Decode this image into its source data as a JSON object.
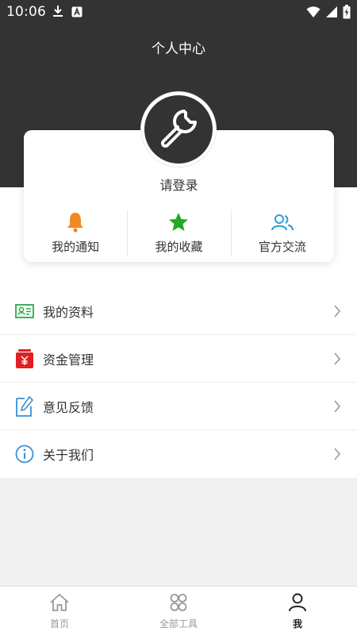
{
  "status_bar": {
    "time": "10:06",
    "left_icons": [
      "download-icon",
      "a-notification-icon"
    ],
    "right_icons": [
      "wifi-icon",
      "signal-icon",
      "battery-charging-icon"
    ]
  },
  "header": {
    "title": "个人中心"
  },
  "profile": {
    "avatar_icon": "wrench-icon",
    "login_label": "请登录"
  },
  "shortcuts": [
    {
      "label": "我的通知",
      "icon": "bell-icon",
      "color": "#f08a24"
    },
    {
      "label": "我的收藏",
      "icon": "star-icon",
      "color": "#22aa22"
    },
    {
      "label": "官方交流",
      "icon": "group-icon",
      "color": "#2f9be0"
    }
  ],
  "menu": [
    {
      "label": "我的资料",
      "icon": "id-card-icon",
      "color": "#2aa84a"
    },
    {
      "label": "资金管理",
      "icon": "yuan-money-icon",
      "color": "#e02020"
    },
    {
      "label": "意见反馈",
      "icon": "edit-icon",
      "color": "#3a8fd8"
    },
    {
      "label": "关于我们",
      "icon": "info-icon",
      "color": "#3a8fd8"
    }
  ],
  "tabbar": [
    {
      "label": "首页",
      "icon": "home-icon",
      "active": false
    },
    {
      "label": "全部工具",
      "icon": "apps-icon",
      "active": false
    },
    {
      "label": "我",
      "icon": "user-icon",
      "active": true
    }
  ]
}
